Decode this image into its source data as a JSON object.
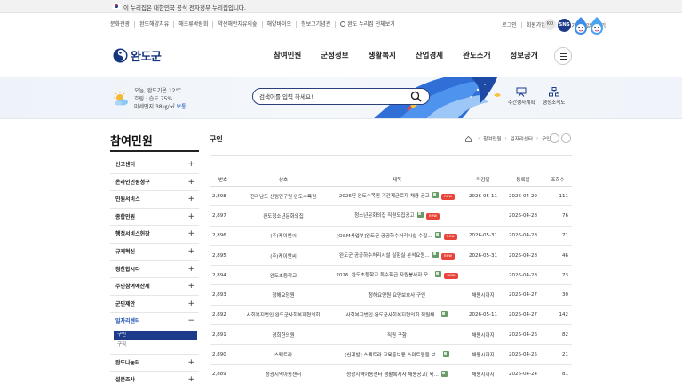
{
  "gov_banner": {
    "text": "이 누리집은 대한민국 공식 전자정부 누리집입니다."
  },
  "util_links": [
    "문화관광",
    "완도해양치유",
    "해조류박람회",
    "약산해안치유의숲",
    "해양바이오",
    "청보고기념관",
    "완도 누리집 전체보기"
  ],
  "util_right": {
    "login": "로그인",
    "join": "회원가입",
    "national": "국가상징알아보기",
    "lang": "KO",
    "sns": "SNS"
  },
  "header": {
    "logo_text": "완도군",
    "gnb": [
      "참여민원",
      "군정정보",
      "생활복지",
      "산업경제",
      "완도소개",
      "정보공개"
    ]
  },
  "hero": {
    "weather_line1": "오늘, 완도기온 12℃",
    "weather_line2": "흐림 · 습도 75%",
    "weather_line3_label": "미세먼지 38㎍/㎥",
    "weather_line3_status": "보통",
    "search_placeholder": "검색어를 입력 하세요!",
    "quick1": "주간행사계획",
    "quick2": "행정조직도"
  },
  "sidebar": {
    "title": "참여민원",
    "items": [
      {
        "label": "신고센터",
        "pm": "+"
      },
      {
        "label": "온라인민원청구",
        "pm": "+"
      },
      {
        "label": "민원서비스",
        "pm": "+"
      },
      {
        "label": "종합민원",
        "pm": "+"
      },
      {
        "label": "행정서비스헌장",
        "pm": "+"
      },
      {
        "label": "규제혁신",
        "pm": "+"
      },
      {
        "label": "칭찬합시다",
        "pm": "+"
      },
      {
        "label": "주민참여예산제",
        "pm": "+"
      },
      {
        "label": "군민제안",
        "pm": "+"
      },
      {
        "label": "일자리센터",
        "pm": "−"
      }
    ],
    "sub_items": [
      "구인",
      "구직"
    ],
    "after_items": [
      {
        "label": "완도나눔터",
        "pm": "+"
      },
      {
        "label": "설문조사",
        "pm": "+"
      }
    ]
  },
  "content": {
    "title": "구인",
    "breadcrumb": [
      "참여민원",
      "일자리센터",
      "구인"
    ],
    "columns": [
      "번호",
      "상호",
      "제목",
      "마감일",
      "등록일",
      "조회수"
    ],
    "rows": [
      {
        "no": "2,898",
        "company": "전라남도 산림연구원 완도수목원",
        "title": "2026년 완도수목원 기간제근로자 채용 공고",
        "file": true,
        "new": true,
        "deadline": "2026-05-11",
        "date": "2026-04-29",
        "hits": "111"
      },
      {
        "no": "2,897",
        "company": "완도청소년문화의집",
        "title": "청소년문화의집 직원모집공고",
        "file": true,
        "new": true,
        "deadline": "",
        "date": "2026-04-28",
        "hits": "76"
      },
      {
        "no": "2,896",
        "company": "(주)케이엔씨",
        "title": "[O&M사업부]완도군 공공하수처리시설 수질...",
        "file": true,
        "new": true,
        "deadline": "2026-05-31",
        "date": "2026-04-28",
        "hits": "71"
      },
      {
        "no": "2,895",
        "company": "(주)케이엔씨",
        "title": "완도군 공공하수처리시설 실험실 분석요원...",
        "file": true,
        "new": true,
        "deadline": "2026-05-31",
        "date": "2026-04-28",
        "hits": "46"
      },
      {
        "no": "2,894",
        "company": "완도초등학교",
        "title": "2026. 완도초등학교 특수학급 자원봉사자 모...",
        "file": true,
        "new": true,
        "deadline": "",
        "date": "2026-04-28",
        "hits": "73"
      },
      {
        "no": "2,893",
        "company": "청해요양원",
        "title": "청해요양원 요양보호사 구인",
        "file": false,
        "new": false,
        "deadline": "채용시까지",
        "date": "2026-04-27",
        "hits": "30"
      },
      {
        "no": "2,892",
        "company": "사회복지법인 완도군사회복지협의회",
        "title": "사회복지법인 완도군사회복지협의회 직원채...",
        "file": true,
        "new": false,
        "deadline": "2026-05-11",
        "date": "2026-04-27",
        "hits": "142"
      },
      {
        "no": "2,891",
        "company": "경희한의원",
        "title": "직원 구함",
        "file": false,
        "new": false,
        "deadline": "채용시까지",
        "date": "2026-04-26",
        "hits": "82"
      },
      {
        "no": "2,890",
        "company": "스펙트라",
        "title": "[신계발] 스펙트라 교육홍보용 스마트원을 보...",
        "file": true,
        "new": false,
        "deadline": "채용시까지",
        "date": "2026-04-25",
        "hits": "21"
      },
      {
        "no": "2,889",
        "company": "성광지역아동센터",
        "title": "성광지역아동센터 생활복지사 채용공고( 육...",
        "file": true,
        "new": false,
        "deadline": "채용시까지",
        "date": "2026-04-24",
        "hits": "81"
      }
    ]
  },
  "colors": {
    "brand": "#1d3b8b",
    "new_badge": "#e8443a"
  }
}
